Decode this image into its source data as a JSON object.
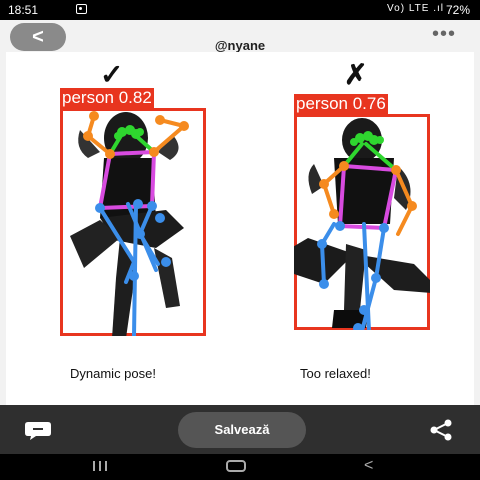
{
  "status_bar": {
    "time": "18:51",
    "indicators": "Vo) LTE .ıl",
    "battery": "72%"
  },
  "header": {
    "back_icon": "<",
    "username": "@nyane",
    "more_icon": "•••"
  },
  "post": {
    "left": {
      "mark": "✓",
      "label": "person 0.82",
      "caption": "Dynamic pose!"
    },
    "right": {
      "mark": "✗",
      "label": "person 0.76",
      "caption": "Too relaxed!"
    }
  },
  "bottom_bar": {
    "save_label": "Salvează"
  },
  "nav": {
    "recent_icon": "|||",
    "home_icon": "home",
    "back_icon": "<"
  },
  "colors": {
    "box": "#e8351f",
    "limb_arm": "#f58a1f",
    "limb_torso": "#d84be0",
    "limb_leg": "#3b8eea",
    "limb_head": "#2fd62f"
  }
}
